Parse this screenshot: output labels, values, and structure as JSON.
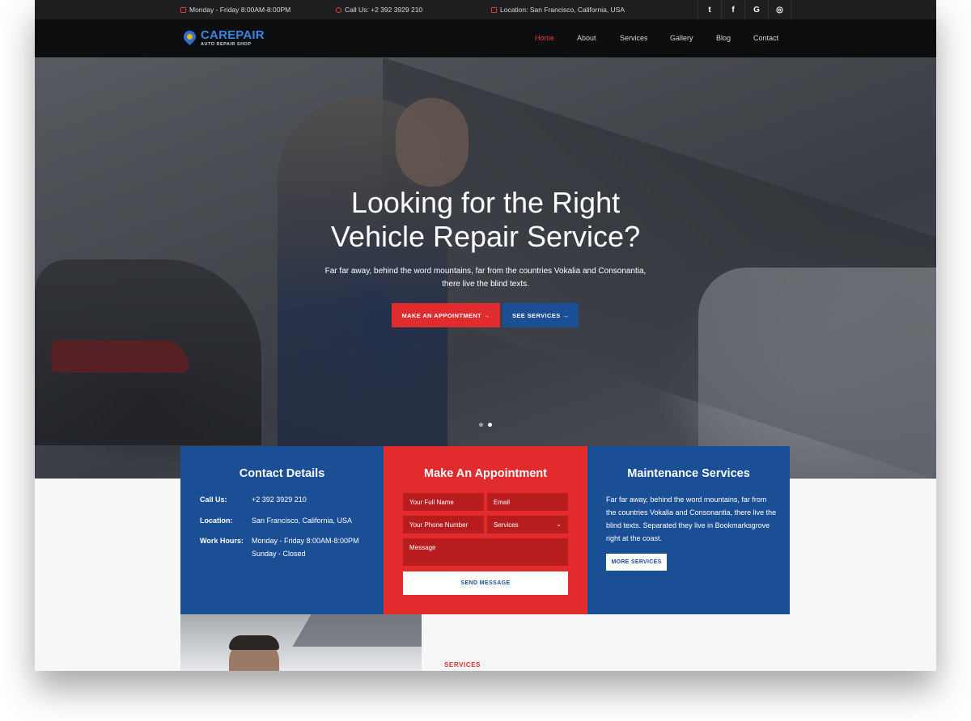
{
  "topbar": {
    "hours": "Monday - Friday 8:00AM-8:00PM",
    "phone": "Call Us: +2 392 3929 210",
    "location": "Location: San Francisco, California, USA",
    "social": [
      {
        "icon": "twitter-icon",
        "glyph": "t"
      },
      {
        "icon": "facebook-icon",
        "glyph": "f"
      },
      {
        "icon": "google-icon",
        "glyph": "G"
      },
      {
        "icon": "instagram-icon",
        "glyph": "◎"
      }
    ]
  },
  "navbar": {
    "brand": "CAREPAIR",
    "tagline": "AUTO REPAIR SHOP",
    "links": [
      "Home",
      "About",
      "Services",
      "Gallery",
      "Blog",
      "Contact"
    ],
    "active": "Home"
  },
  "hero": {
    "title_line1": "Looking for the Right",
    "title_line2": "Vehicle Repair Service?",
    "sub_line1": "Far far away, behind the word mountains, far from the countries Vokalia and Consonantia,",
    "sub_line2": "there live the blind texts.",
    "primary_button": "MAKE AN APPOINTMENT  →",
    "secondary_button": "SEE SERVICES  →",
    "slides": 2,
    "active_slide": 2
  },
  "contact": {
    "title": "Contact Details",
    "call_label": "Call Us:",
    "call_value": "+2 392 3929 210",
    "location_label": "Location:",
    "location_value": "San Francisco, California, USA",
    "hours_label": "Work Hours:",
    "hours_value1": "Monday - Friday 8:00AM-8:00PM",
    "hours_value2": "Sunday - Closed"
  },
  "appointment": {
    "title": "Make An Appointment",
    "name_placeholder": "Your Full Name",
    "email_placeholder": "Email",
    "phone_placeholder": "Your Phone Number",
    "services_select": "Services",
    "message_placeholder": "Message",
    "send_button": "SEND MESSAGE"
  },
  "maintenance": {
    "title": "Maintenance Services",
    "text": "Far far away, behind the word mountains, far from the countries Vokalia and Consonantia, there live the blind texts. Separated they live in Bookmarksgrove right at the coast.",
    "button": "MORE SERVICES"
  },
  "services_section": {
    "label": "SERVICES"
  },
  "colors": {
    "accent_red": "#e02c2f",
    "brand_blue": "#1a4f96",
    "topbar_bg": "#1e1f21",
    "navbar_bg": "#0c0d0f"
  }
}
